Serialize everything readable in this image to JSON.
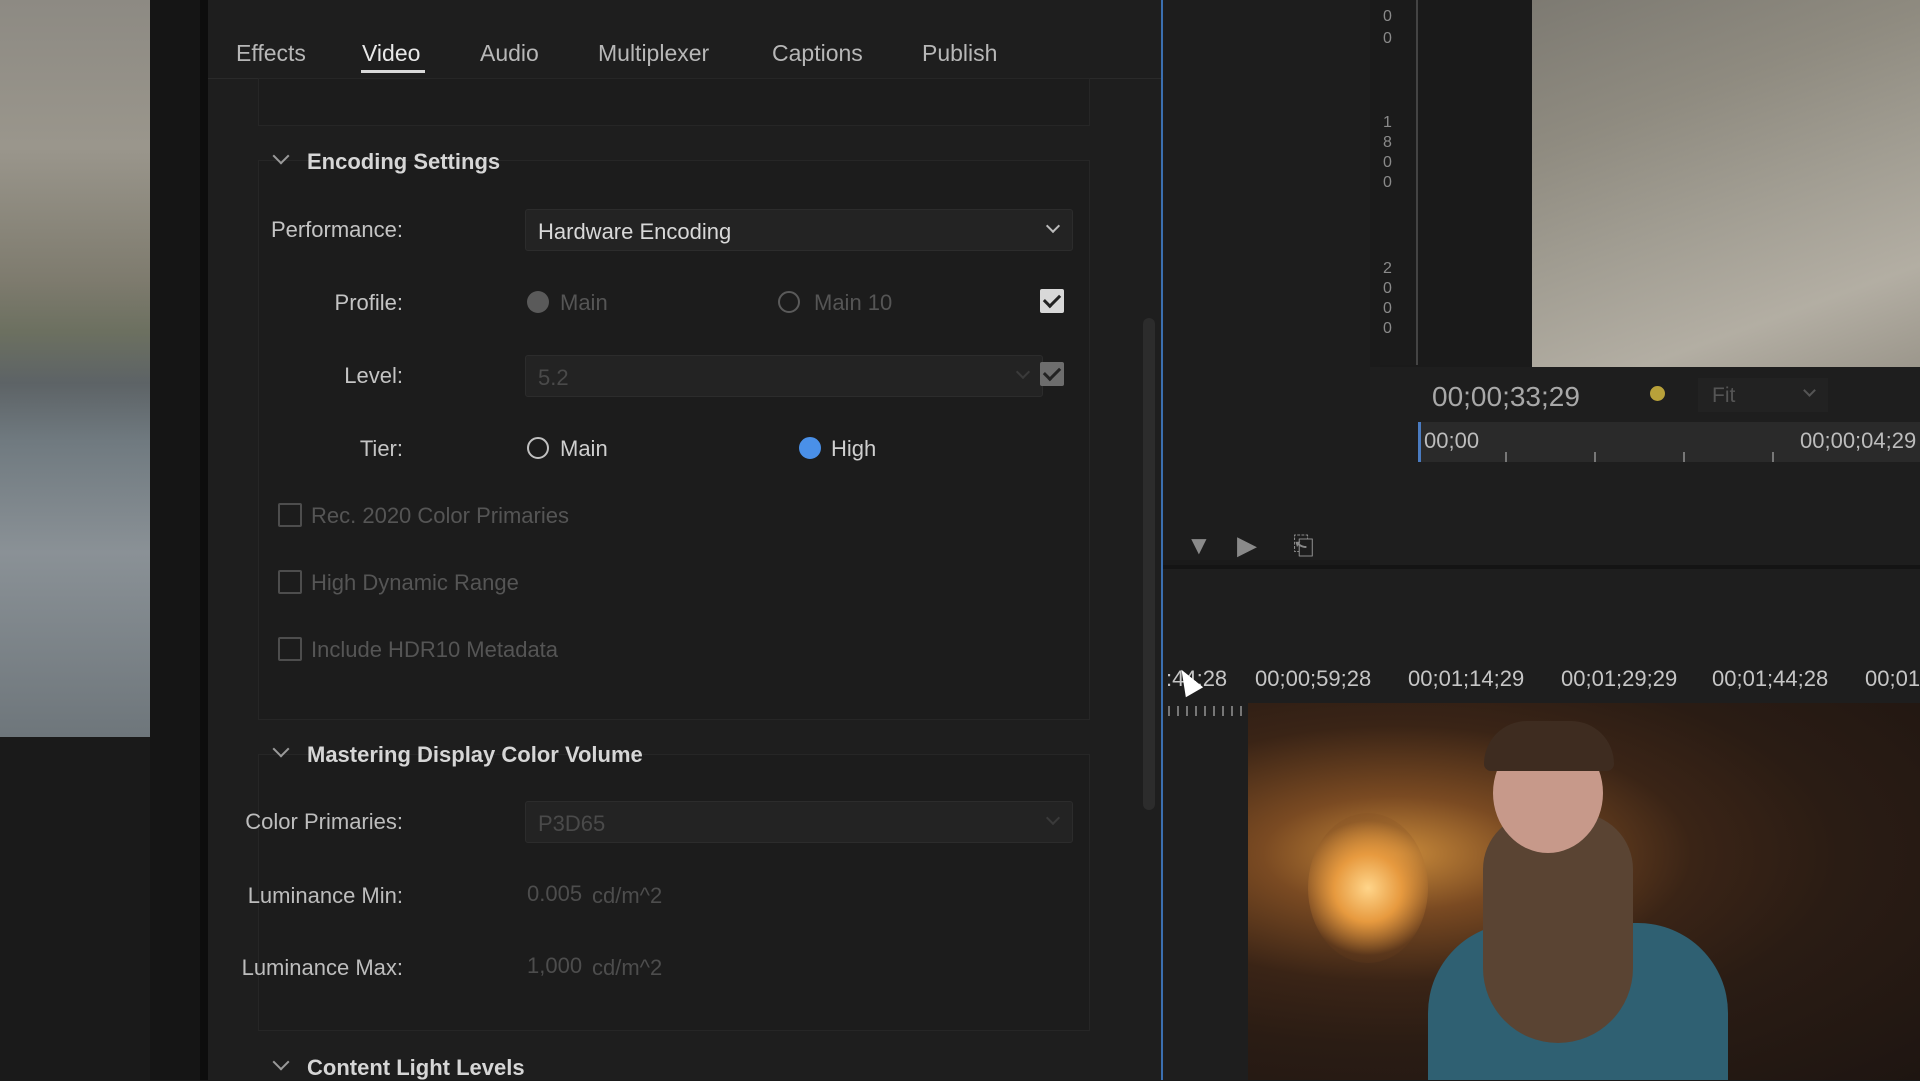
{
  "tabs": [
    {
      "label": "Effects",
      "active": false
    },
    {
      "label": "Video",
      "active": true
    },
    {
      "label": "Audio",
      "active": false
    },
    {
      "label": "Multiplexer",
      "active": false
    },
    {
      "label": "Captions",
      "active": false
    },
    {
      "label": "Publish",
      "active": false
    }
  ],
  "encoding": {
    "header": "Encoding Settings",
    "performance_label": "Performance:",
    "performance_value": "Hardware Encoding",
    "profile_label": "Profile:",
    "profile_options": [
      "Main",
      "Main 10"
    ],
    "profile_selected": "Main",
    "level_label": "Level:",
    "level_value": "5.2",
    "tier_label": "Tier:",
    "tier_options": [
      "Main",
      "High"
    ],
    "tier_selected": "High",
    "rec2020_label": "Rec. 2020 Color Primaries",
    "hdr_label": "High Dynamic Range",
    "hdr10_label": "Include HDR10 Metadata"
  },
  "mastering": {
    "header": "Mastering Display Color Volume",
    "color_primaries_label": "Color Primaries:",
    "color_primaries_value": "P3D65",
    "lum_min_label": "Luminance Min:",
    "lum_min_value": "0.005",
    "lum_min_unit": "cd/m^2",
    "lum_max_label": "Luminance Max:",
    "lum_max_value": "1,000",
    "lum_max_unit": "cd/m^2"
  },
  "content_light": {
    "header": "Content Light Levels"
  },
  "ruler_digits": [
    "0",
    "0",
    "1",
    "8",
    "0",
    "0",
    "2",
    "0",
    "0",
    "0"
  ],
  "monitor": {
    "timecode": "00;00;33;29",
    "fit_value": "Fit",
    "mini_start": "00;00",
    "mini_end": "00;00;04;29"
  },
  "timeline": {
    "timecodes": [
      ":44;28",
      "00;00;59;28",
      "00;01;14;29",
      "00;01;29;29",
      "00;01;44;28",
      "00;01"
    ]
  },
  "colors": {
    "accent_blue": "#4a90e8",
    "panel_bg": "#1e1e1e"
  }
}
